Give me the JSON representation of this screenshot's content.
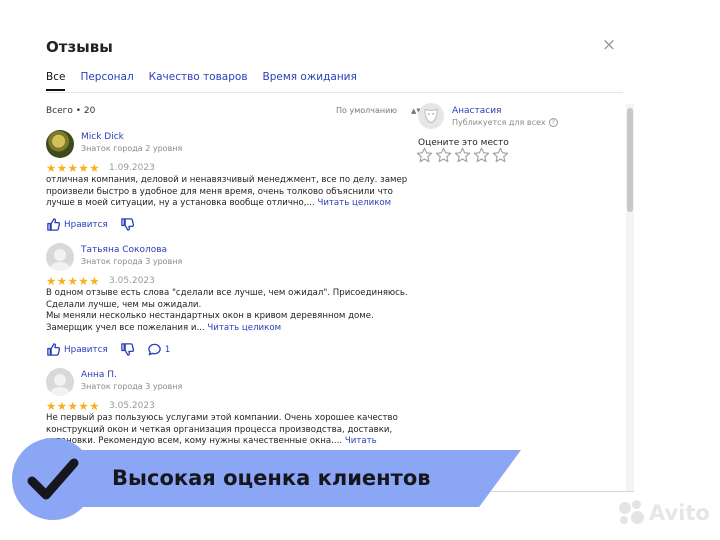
{
  "header": {
    "title": "Отзывы",
    "close_label": "×"
  },
  "tabs": [
    {
      "label": "Все",
      "active": true
    },
    {
      "label": "Персонал",
      "active": false
    },
    {
      "label": "Качество товаров",
      "active": false
    },
    {
      "label": "Время ожидания",
      "active": false
    }
  ],
  "list": {
    "total": "Всего • 20",
    "sort": "По умолчанию",
    "sort_arrows": "▲▼"
  },
  "reviews": [
    {
      "name": "Mick Dick",
      "level": "Знаток города 2 уровня",
      "stars": "★★★★★",
      "rating": 5,
      "date": "1.09.2023",
      "text": "отличная компания, деловой и ненавязчивый менеджмент, все по делу. замер произвели быстро в удобное для меня время, очень толково объяснили что лучше в моей ситуации, ну а установка вообще отлично,... ",
      "more": "Читать целиком",
      "like": "Нравится",
      "comments": ""
    },
    {
      "name": "Татьяна Соколова",
      "level": "Знаток города 3 уровня",
      "stars": "★★★★★",
      "rating": 5,
      "date": "3.05.2023",
      "text_lines": [
        "В одном отзыве есть слова \"сделали все лучше, чем ожидал\". Присоединяюсь.",
        "Сделали лучше, чем мы ожидали.",
        "Мы меняли несколько нестандартных окон в кривом деревянном доме.",
        "Замерщик учел все пожелания и... "
      ],
      "more": "Читать целиком",
      "like": "Нравится",
      "comments": "1"
    },
    {
      "name": "Анна П.",
      "level": "Знаток города 3 уровня",
      "stars": "★★★★★",
      "rating": 5,
      "date": "3.05.2023",
      "text": "Не первый раз пользуюсь услугами этой компании. Очень хорошее качество конструкций окон и четкая организация процесса производства, доставки, установки. Рекомендую всем, кому нужны качественные окна.... ",
      "more": "Читать целиком"
    }
  ],
  "sidebar": {
    "user_name": "Анастасия",
    "publish_note": "Публикуется для всех",
    "help_glyph": "?",
    "rate_title": "Оцените это место",
    "rate_stars": 5
  },
  "banner": {
    "text": "Высокая оценка клиентов"
  },
  "watermark": {
    "text": "Avito"
  },
  "colors": {
    "link": "#2a3fb8",
    "star": "#f5b21b",
    "banner": "#8aa6f5"
  }
}
